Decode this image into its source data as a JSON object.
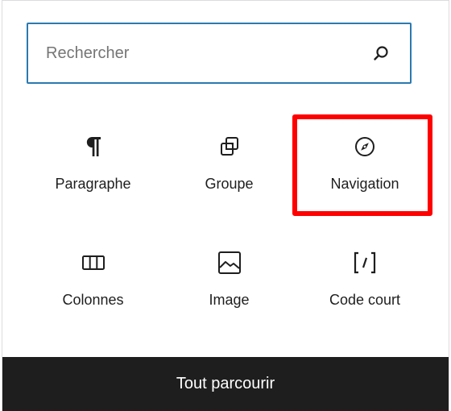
{
  "search": {
    "placeholder": "Rechercher",
    "value": ""
  },
  "blocks": [
    {
      "label": "Paragraphe",
      "icon": "paragraph-icon"
    },
    {
      "label": "Groupe",
      "icon": "group-icon"
    },
    {
      "label": "Navigation",
      "icon": "compass-icon",
      "highlighted": true
    },
    {
      "label": "Colonnes",
      "icon": "columns-icon"
    },
    {
      "label": "Image",
      "icon": "image-icon"
    },
    {
      "label": "Code court",
      "icon": "shortcode-icon"
    }
  ],
  "footer": {
    "browse_all_label": "Tout parcourir"
  },
  "colors": {
    "search_border": "#2a7ab0",
    "highlight": "#ff0000",
    "footer_bg": "#1e1e1e",
    "text": "#1e1e1e"
  }
}
